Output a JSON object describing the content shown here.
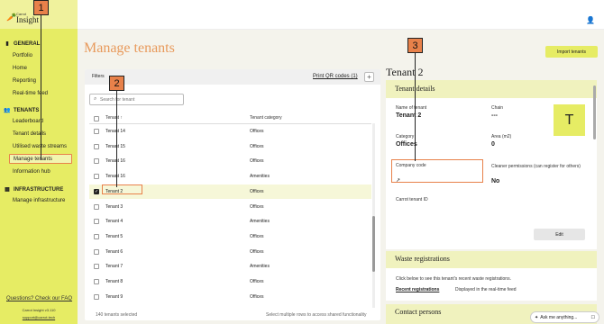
{
  "brand": {
    "small": "Carrot",
    "name": "Insight"
  },
  "sidebar": {
    "sections": [
      {
        "title": "GENERAL",
        "icon": "bar-chart-icon"
      },
      {
        "title": "TENANTS",
        "icon": "users-icon"
      },
      {
        "title": "INFRASTRUCTURE",
        "icon": "building-icon"
      }
    ],
    "items": [
      "Portfolio",
      "Home",
      "Reporting",
      "Real-time feed",
      "Leaderboard",
      "Tenant details",
      "Utilised waste streams",
      "Manage tenants",
      "Information hub",
      "Manage infrastructure"
    ],
    "faq": "Questions? Check our FAQ",
    "version": "Carrot Insight v3.110",
    "support": "support@carrot.tech"
  },
  "page": {
    "title": "Manage tenants",
    "import_button": "Import tenants"
  },
  "table": {
    "filters": "Filters",
    "qr_link": "Print QR codes (1)",
    "search_placeholder": "Search for tenant",
    "columns": [
      "Tenant",
      "Tenant category"
    ],
    "sort_glyph": "↑",
    "rows": [
      {
        "name": "Tenant 14",
        "category": "Offices",
        "selected": false
      },
      {
        "name": "Tenant 15",
        "category": "Offices",
        "selected": false
      },
      {
        "name": "Tenant 16",
        "category": "Offices",
        "selected": false
      },
      {
        "name": "Tenant 16",
        "category": "Amenities",
        "selected": false
      },
      {
        "name": "Tenant 2",
        "category": "Offices",
        "selected": true
      },
      {
        "name": "Tenant 3",
        "category": "Offices",
        "selected": false
      },
      {
        "name": "Tenant 4",
        "category": "Amenities",
        "selected": false
      },
      {
        "name": "Tenant 5",
        "category": "Offices",
        "selected": false
      },
      {
        "name": "Tenant 6",
        "category": "Offices",
        "selected": false
      },
      {
        "name": "Tenant 7",
        "category": "Amenities",
        "selected": false
      },
      {
        "name": "Tenant 8",
        "category": "Offices",
        "selected": false
      },
      {
        "name": "Tenant 9",
        "category": "Offices",
        "selected": false
      }
    ],
    "footer_count": "140 tenants selected",
    "footer_hint": "Select multiple rows to access shared functionality"
  },
  "detail": {
    "title": "Tenant 2",
    "section": "Tenant details",
    "name_label": "Name of tenant",
    "name_value": "Tenant 2",
    "chain_label": "Chain",
    "chain_value": "---",
    "avatar": "T",
    "category_label": "Category",
    "category_value": "Offices",
    "area_label": "Area (m2)",
    "area_value": "0",
    "company_label": "Company code",
    "cleaner_label": "Cleaner permissions (can register for others)",
    "cleaner_value": "No",
    "carrot_id_label": "Carrot tenant ID",
    "edit_button": "Edit"
  },
  "waste": {
    "title": "Waste registrations",
    "text": "Click below to see this tenant's recent waste registrations.",
    "link": "Recent registrations",
    "note": "Displayed in the real-time feed"
  },
  "contact": {
    "title": "Contact persons"
  },
  "ask": {
    "label": "Ask me anything..."
  },
  "annotations": [
    "1",
    "2",
    "3"
  ]
}
